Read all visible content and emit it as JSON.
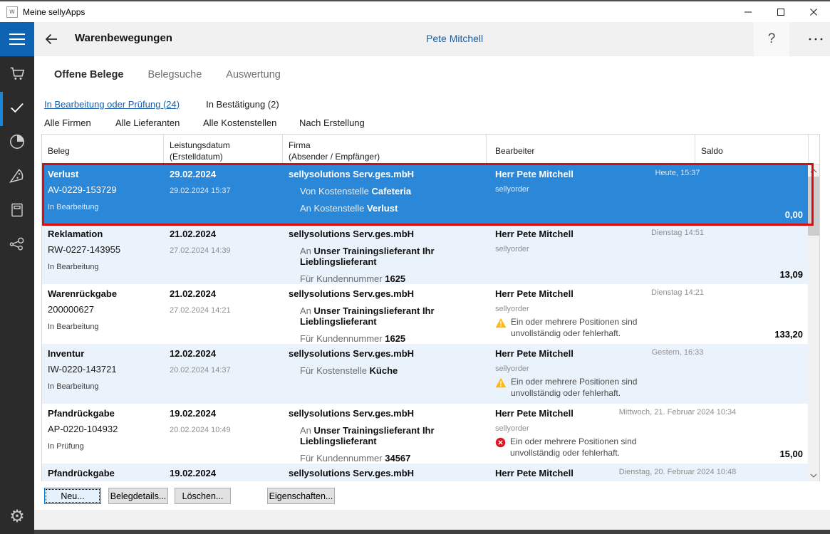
{
  "window": {
    "title": "Meine sellyApps"
  },
  "header": {
    "title": "Warenbewegungen",
    "user": "Pete Mitchell",
    "help_label": "?"
  },
  "tabs": [
    {
      "label": "Offene Belege",
      "active": true
    },
    {
      "label": "Belegsuche",
      "active": false
    },
    {
      "label": "Auswertung",
      "active": false
    }
  ],
  "status_filters": [
    {
      "label": "In Bearbeitung oder Prüfung (24)",
      "active": true
    },
    {
      "label": "In Bestätigung (2)",
      "active": false
    }
  ],
  "dropdown_filters": [
    "Alle Firmen",
    "Alle Lieferanten",
    "Alle Kostenstellen",
    "Nach Erstellung"
  ],
  "table": {
    "columns": [
      {
        "line1": "Beleg",
        "line2": ""
      },
      {
        "line1": "Leistungsdatum",
        "line2": "(Erstelldatum)"
      },
      {
        "line1": "Firma",
        "line2": "(Absender / Empfänger)"
      },
      {
        "line1": "Bearbeiter",
        "line2": ""
      },
      {
        "line1": "Saldo",
        "line2": ""
      }
    ],
    "rows": [
      {
        "selected": true,
        "type": "Verlust",
        "number": "AV-0229-153729",
        "status": "In Bearbeitung",
        "date": "29.02.2024",
        "created": "29.02.2024 15:37",
        "company": "sellysolutions Serv.ges.mbH",
        "lines": [
          {
            "prefix": "Von Kostenstelle",
            "value": "Cafeteria"
          },
          {
            "prefix": "An Kostenstelle",
            "value": "Verlust"
          }
        ],
        "editor": "Herr Pete Mitchell",
        "editor_sub": "sellyorder",
        "timestamp": "Heute, 15:37",
        "saldo": "0,00"
      },
      {
        "type": "Reklamation",
        "number": "RW-0227-143955",
        "status": "In Bearbeitung",
        "date": "21.02.2024",
        "created": "27.02.2024 14:39",
        "company": "sellysolutions Serv.ges.mbH",
        "lines": [
          {
            "prefix": "An",
            "value": "Unser Trainingslieferant Ihr Lieblingslieferant"
          },
          {
            "prefix": "Für Kundennummer",
            "value": "1625"
          }
        ],
        "editor": "Herr Pete Mitchell",
        "editor_sub": "sellyorder",
        "timestamp": "Dienstag 14:51",
        "saldo": "13,09"
      },
      {
        "type": "Warenrückgabe",
        "number": "200000627",
        "status": "In Bearbeitung",
        "date": "21.02.2024",
        "created": "27.02.2024 14:21",
        "company": "sellysolutions Serv.ges.mbH",
        "lines": [
          {
            "prefix": "An",
            "value": "Unser Trainingslieferant Ihr Lieblingslieferant"
          },
          {
            "prefix": "Für Kundennummer",
            "value": "1625"
          }
        ],
        "editor": "Herr Pete Mitchell",
        "editor_sub": "sellyorder",
        "timestamp": "Dienstag 14:21",
        "alert": {
          "type": "warning",
          "text": "Ein oder mehrere Positionen sind unvollständig oder fehlerhaft."
        },
        "saldo": "133,20"
      },
      {
        "type": "Inventur",
        "number": "IW-0220-143721",
        "status": "In Bearbeitung",
        "date": "12.02.2024",
        "created": "20.02.2024 14:37",
        "company": "sellysolutions Serv.ges.mbH",
        "lines": [
          {
            "prefix": "Für Kostenstelle",
            "value": "Küche"
          }
        ],
        "editor": "Herr Pete Mitchell",
        "editor_sub": "sellyorder",
        "timestamp": "Gestern, 16:33",
        "alert": {
          "type": "warning",
          "text": "Ein oder mehrere Positionen sind unvollständig oder fehlerhaft."
        },
        "saldo": ""
      },
      {
        "type": "Pfandrückgabe",
        "number": "AP-0220-104932",
        "status": "In Prüfung",
        "date": "19.02.2024",
        "created": "20.02.2024 10:49",
        "company": "sellysolutions Serv.ges.mbH",
        "lines": [
          {
            "prefix": "An",
            "value": "Unser Trainingslieferant Ihr Lieblingslieferant"
          },
          {
            "prefix": "Für Kundennummer",
            "value": "34567"
          }
        ],
        "editor": "Herr Pete Mitchell",
        "editor_sub": "sellyorder",
        "timestamp": "Mittwoch, 21. Februar 2024 10:34",
        "alert": {
          "type": "error",
          "text": "Ein oder mehrere Positionen sind unvollständig oder fehlerhaft."
        },
        "saldo": "15,00"
      },
      {
        "type": "Pfandrückgabe",
        "number": "",
        "status": "",
        "date": "19.02.2024",
        "created": "",
        "company": "sellysolutions Serv.ges.mbH",
        "lines": [],
        "editor": "Herr Pete Mitchell",
        "editor_sub": "",
        "timestamp": "Dienstag, 20. Februar 2024 10:48",
        "saldo": ""
      }
    ]
  },
  "actions": [
    "Neu...",
    "Belegdetails...",
    "Löschen...",
    "Eigenschaften..."
  ],
  "icons": {
    "sidebar": [
      "hamburger",
      "cart",
      "check",
      "pie-chart",
      "pizza",
      "book",
      "share",
      "settings"
    ],
    "row_alerts": [
      "warning-triangle",
      "error-circle"
    ]
  },
  "colors": {
    "selection_blue": "#2b87d8",
    "selection_border_red": "#dd0c0c",
    "link_blue": "#1b5fa8",
    "username_blue": "#1b5c9b",
    "hamburger_blue": "#0e63b3",
    "sidebar_dark": "#2b2b2b",
    "header_gray": "#f1f1f1",
    "alt_row_blue": "#eaf2fb",
    "warning_yellow": "#fcb81b",
    "error_red": "#e01625"
  }
}
